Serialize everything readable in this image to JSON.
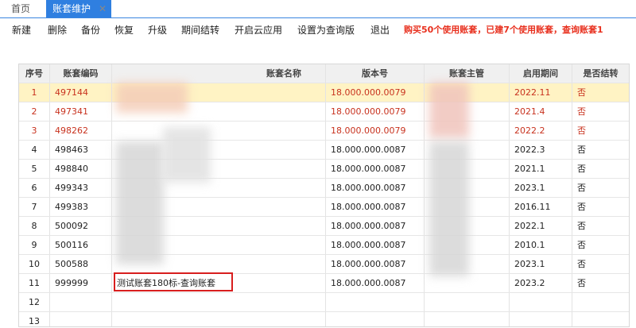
{
  "tabs": {
    "home": "首页",
    "active": "账套维护",
    "close": "✕"
  },
  "toolbar": {
    "buttons": [
      "新建",
      "删除",
      "备份",
      "恢复",
      "升级",
      "期间结转",
      "开启云应用",
      "设置为查询版",
      "退出"
    ],
    "notice": "购买50个使用账套，已建7个使用账套，查询账套1"
  },
  "table": {
    "headers": [
      "序号",
      "账套编码",
      "账套名称",
      "版本号",
      "账套主管",
      "启用期间",
      "是否结转"
    ],
    "rows": [
      {
        "no": "1",
        "code": "497144",
        "name": "",
        "version": "18.000.000.0079",
        "manager": "",
        "period": "2022.11",
        "carry": "否"
      },
      {
        "no": "2",
        "code": "497341",
        "name": "",
        "version": "18.000.000.0079",
        "manager": "",
        "period": "2021.4",
        "carry": "否"
      },
      {
        "no": "3",
        "code": "498262",
        "name": "",
        "version": "18.000.000.0079",
        "manager": "",
        "period": "2022.2",
        "carry": "否"
      },
      {
        "no": "4",
        "code": "498463",
        "name": "",
        "version": "18.000.000.0087",
        "manager": "",
        "period": "2022.3",
        "carry": "否"
      },
      {
        "no": "5",
        "code": "498840",
        "name": "",
        "version": "18.000.000.0087",
        "manager": "",
        "period": "2021.1",
        "carry": "否"
      },
      {
        "no": "6",
        "code": "499343",
        "name": "",
        "version": "18.000.000.0087",
        "manager": "",
        "period": "2023.1",
        "carry": "否"
      },
      {
        "no": "7",
        "code": "499383",
        "name": "",
        "version": "18.000.000.0087",
        "manager": "",
        "period": "2016.11",
        "carry": "否"
      },
      {
        "no": "8",
        "code": "500092",
        "name": "",
        "version": "18.000.000.0087",
        "manager": "",
        "period": "2022.1",
        "carry": "否"
      },
      {
        "no": "9",
        "code": "500116",
        "name": "",
        "version": "18.000.000.0087",
        "manager": "",
        "period": "2010.1",
        "carry": "否"
      },
      {
        "no": "10",
        "code": "500588",
        "name": "",
        "version": "18.000.000.0087",
        "manager": "",
        "period": "2023.1",
        "carry": "否"
      },
      {
        "no": "11",
        "code": "999999",
        "name": "测试账套180标-查询账套",
        "version": "18.000.000.0087",
        "manager": "",
        "period": "2023.2",
        "carry": "否"
      },
      {
        "no": "12",
        "code": "",
        "name": "",
        "version": "",
        "manager": "",
        "period": "",
        "carry": ""
      },
      {
        "no": "13",
        "code": "",
        "name": "",
        "version": "",
        "manager": "",
        "period": "",
        "carry": ""
      }
    ]
  },
  "colors": {
    "accent": "#2f7fe0",
    "notice": "#e8301e",
    "highlight_row": "#fff3c4",
    "red_text": "#c8321e",
    "box": "#d81e1e"
  }
}
